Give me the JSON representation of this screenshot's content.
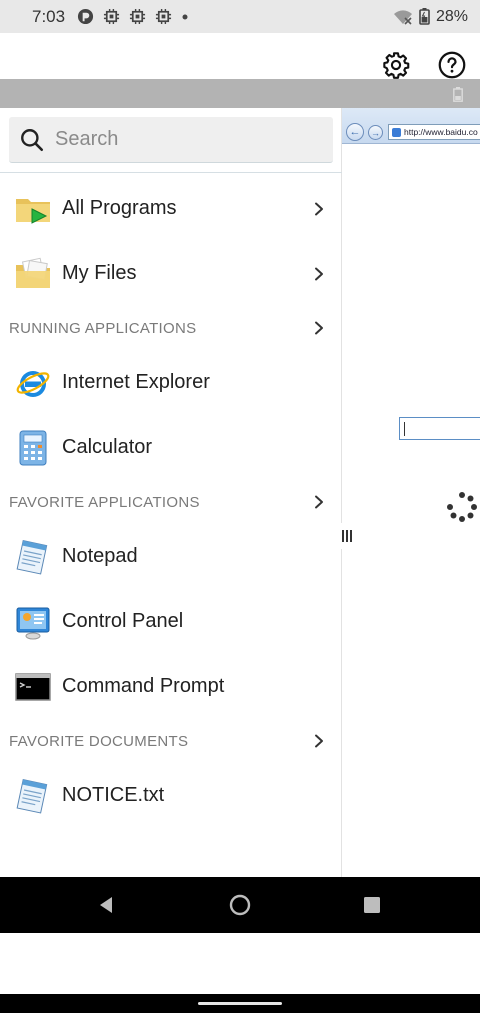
{
  "status_bar": {
    "time": "7:03",
    "battery": "28%",
    "icons": [
      "app-notification-icon",
      "cpu-icon",
      "cpu-icon",
      "cpu-icon",
      "dot-icon",
      "wifi-off-icon",
      "battery-icon"
    ]
  },
  "toolbar": {
    "settings_icon": "gear-icon",
    "help_icon": "help-circle-icon"
  },
  "drawer": {
    "search_placeholder": "Search",
    "rows": [
      {
        "kind": "item",
        "label": "All Programs",
        "icon": "programs-folder-icon",
        "chevron": true
      },
      {
        "kind": "item",
        "label": "My Files",
        "icon": "files-folder-icon",
        "chevron": true
      },
      {
        "kind": "section",
        "label": "RUNNING APPLICATIONS",
        "chevron": true
      },
      {
        "kind": "item",
        "label": "Internet Explorer",
        "icon": "internet-explorer-icon",
        "chevron": false
      },
      {
        "kind": "item",
        "label": "Calculator",
        "icon": "calculator-icon",
        "chevron": false
      },
      {
        "kind": "section",
        "label": "FAVORITE APPLICATIONS",
        "chevron": true
      },
      {
        "kind": "item",
        "label": "Notepad",
        "icon": "notepad-icon",
        "chevron": false
      },
      {
        "kind": "item",
        "label": "Control Panel",
        "icon": "control-panel-icon",
        "chevron": false
      },
      {
        "kind": "item",
        "label": "Command Prompt",
        "icon": "command-prompt-icon",
        "chevron": false
      },
      {
        "kind": "section",
        "label": "FAVORITE DOCUMENTS",
        "chevron": true
      },
      {
        "kind": "item",
        "label": "NOTICE.txt",
        "icon": "text-document-icon",
        "chevron": false
      }
    ]
  },
  "remote": {
    "ie_address": "http://www.baidu.co"
  },
  "colors": {
    "status_bar_bg": "#e8e8e8",
    "remote_topbar_bg": "#b3b3b3",
    "nav_bar_bg": "#000000"
  }
}
